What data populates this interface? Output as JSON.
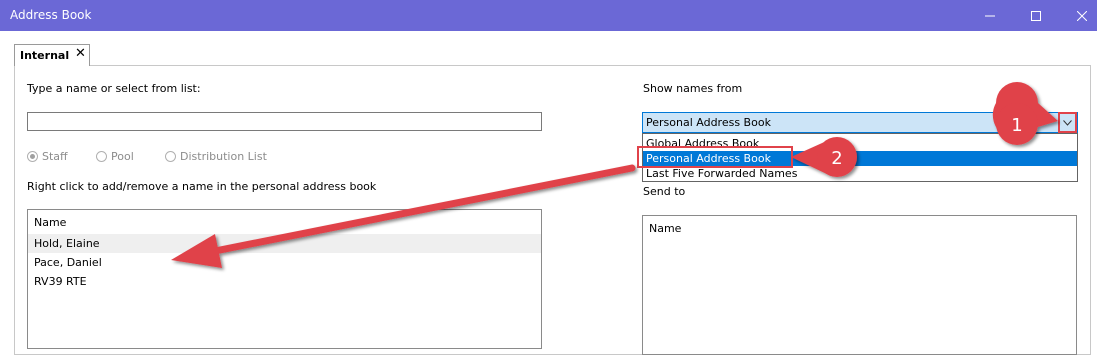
{
  "window": {
    "title": "Address Book",
    "controls": [
      "minimize",
      "maximize",
      "close"
    ]
  },
  "tab": {
    "label": "Internal",
    "close_icon": "close-icon"
  },
  "left": {
    "search_label": "Type a name or select from list:",
    "search_value": "",
    "radios": [
      {
        "label": "Staff",
        "checked": true
      },
      {
        "label": "Pool",
        "checked": false
      },
      {
        "label": "Distribution List",
        "checked": false
      }
    ],
    "hint": "Right click to add/remove a name in the personal address book",
    "list_header": "Name",
    "names": [
      "Hold, Elaine",
      "Pace, Daniel",
      "RV39 RTE"
    ]
  },
  "right": {
    "show_names_label": "Show names from",
    "combo_value": "Personal Address Book",
    "options": [
      "Global Address Book",
      "Personal Address Book",
      "Last Five Forwarded Names"
    ],
    "selected_option": "Personal Address Book",
    "send_to_label": "Send to",
    "list_header": "Name"
  },
  "annotations": {
    "callout_1": "1",
    "callout_2": "2",
    "color": "#e0424a"
  },
  "colors": {
    "titlebar": "#6b68d6",
    "selection": "#0078d7",
    "combo_bg": "#cce4f7"
  }
}
